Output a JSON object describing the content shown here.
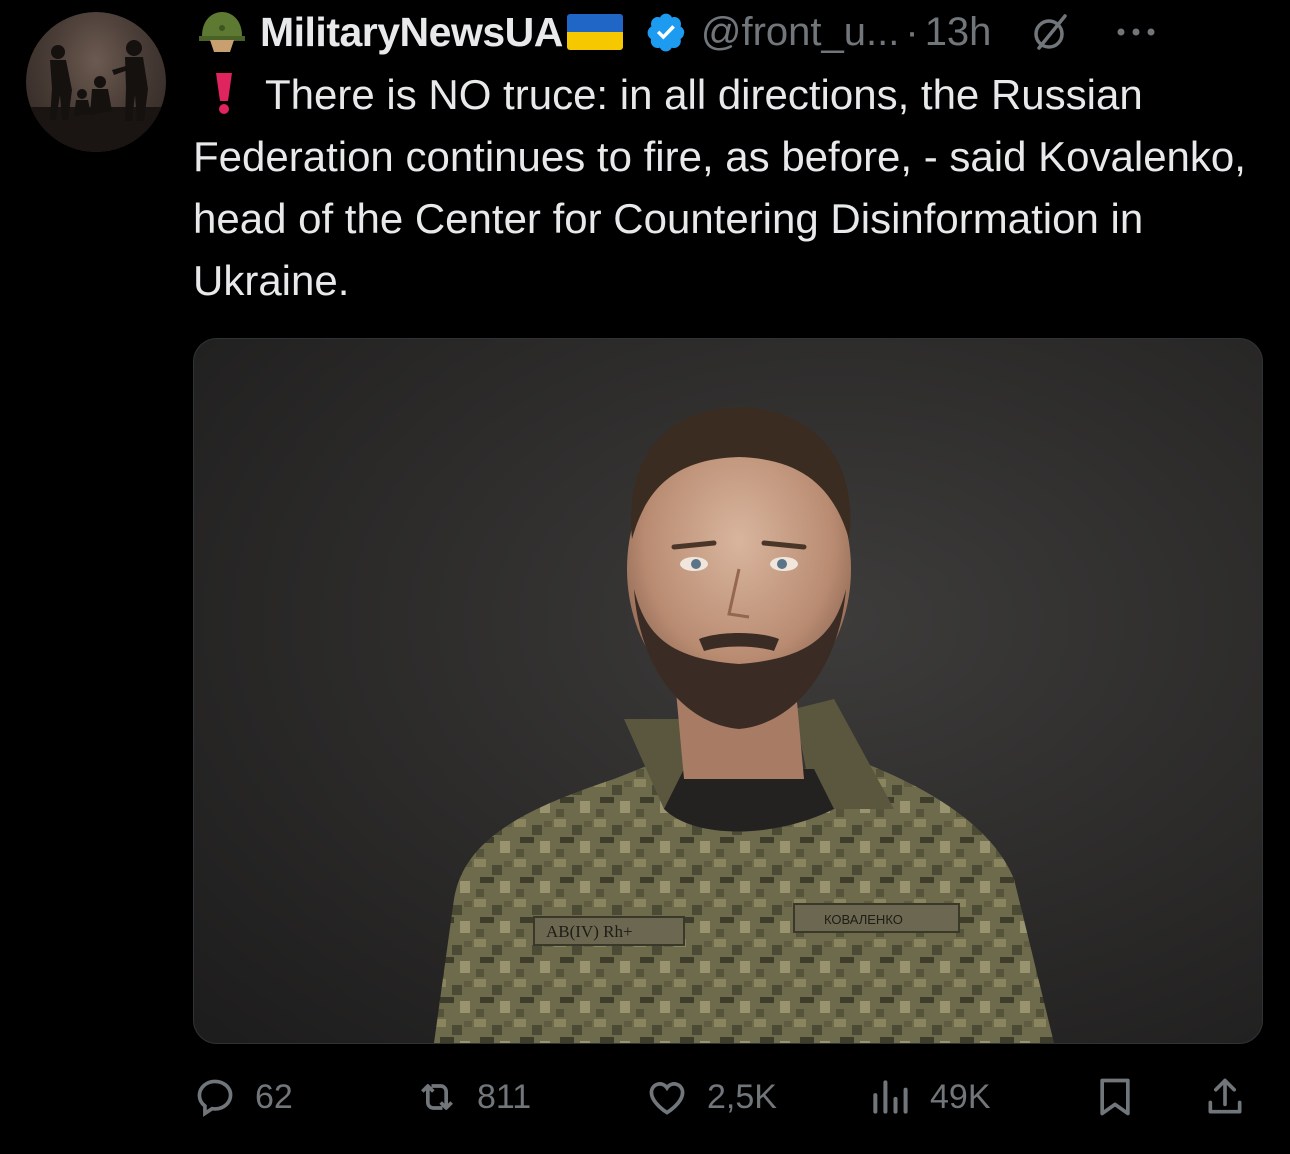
{
  "tweet": {
    "display_name": "MilitaryNewsUA",
    "handle": "@front_u...",
    "separator": "·",
    "time": "13h",
    "text": "There is NO truce: in all directions, the Russian Federation continues to fire, as before, - said Kovalenko, head of the Center for Countering Disinformation in Ukraine.",
    "media_patches": {
      "patch_left": "AB(IV) Rh+",
      "patch_right": "КОВАЛЕНКО"
    }
  },
  "actions": {
    "replies": "62",
    "reposts": "811",
    "likes": "2,5K",
    "views": "49K"
  },
  "icons": {
    "name_prefix": "military-helmet-emoji",
    "flag": "ukraine-flag-emoji",
    "badge": "verified-badge-icon",
    "text_prefix": "red-exclamation-emoji",
    "grok": "grok-icon",
    "more": "more-dots-icon",
    "reply": "reply-icon",
    "repost": "repost-icon",
    "like": "heart-icon",
    "views": "views-icon",
    "bookmark": "bookmark-icon",
    "share": "share-icon"
  },
  "colors": {
    "background": "#000000",
    "text": "#e7e9ea",
    "muted": "#71767b",
    "verified": "#1d9bf0",
    "flag_blue": "#1f66c7",
    "flag_yellow": "#f6c800",
    "exclamation": "#e0245e"
  }
}
